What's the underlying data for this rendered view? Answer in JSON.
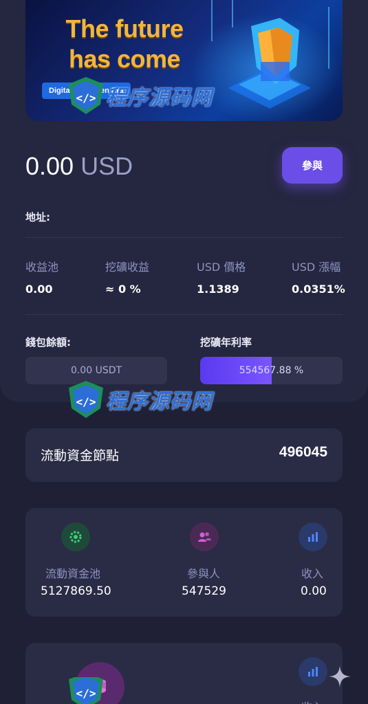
{
  "banner": {
    "title": "The future has come",
    "subtitle": "Digital the Token Era"
  },
  "balance": {
    "amount": "0.00",
    "currency": "USD"
  },
  "join_button": "參與",
  "address_label": "地址:",
  "stats": [
    {
      "label": "收益池",
      "value": "0.00"
    },
    {
      "label": "挖礦收益",
      "value": "≈ 0 %"
    },
    {
      "label": "USD 價格",
      "value": "1.1389"
    },
    {
      "label": "USD 漲幅",
      "value": "0.0351%"
    }
  ],
  "wallet": {
    "label": "錢包餘額:",
    "value": "0.00 USDT"
  },
  "apr": {
    "label": "挖礦年利率",
    "value": "554567.88 %",
    "fill_fraction": 0.5
  },
  "liquidity_node": {
    "label": "流動資金節點",
    "value": "496045"
  },
  "pool_stats": [
    {
      "label": "流動資金池",
      "value": "5127869.50",
      "icon": "gear-icon",
      "color": "#3bd17a"
    },
    {
      "label": "參與人",
      "value": "547529",
      "icon": "users-icon",
      "color": "#d45fd8"
    },
    {
      "label": "收入",
      "value": "0.00",
      "icon": "bar-chart-icon",
      "color": "#4f86ff"
    }
  ],
  "bottom_card": {
    "label": "收入"
  },
  "watermark": "程序源码网",
  "colors": {
    "accent": "#6b4ee8",
    "background": "#1f2036",
    "panel": "#25263f",
    "card": "#2a2b45"
  }
}
